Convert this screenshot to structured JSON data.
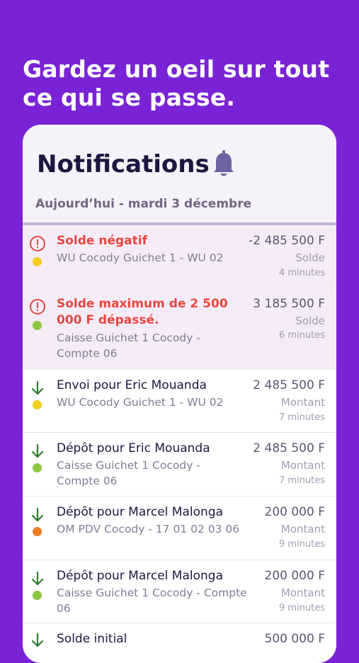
{
  "headline": "Gardez un oeil sur tout ce qui se passe.",
  "card": {
    "title": "Notifications",
    "date": "Aujourd’hui - mardi 3 décembre"
  },
  "colors": {
    "background": "#7a22d6",
    "alert_red": "#e8483d",
    "arrow_green": "#2e7d32",
    "dot_yellow": "#f4cf1e",
    "dot_green": "#8cc63f",
    "dot_orange": "#ee7b23"
  },
  "notifications": [
    {
      "icon": "alert-circle-icon",
      "dot": "yellow",
      "title": "Solde négatif",
      "subtitle": "WU Cocody Guichet 1 - WU 02",
      "amount": "-2 485 500 F",
      "label": "Solde",
      "time": "4 minutes"
    },
    {
      "icon": "alert-circle-icon",
      "dot": "green",
      "title": "Solde maximum de 2 500 000 F dépassé.",
      "subtitle": "Caisse Guichet 1 Cocody - Compte 06",
      "amount": "3 185 500 F",
      "label": "Solde",
      "time": "6 minutes"
    },
    {
      "icon": "arrow-down-icon",
      "dot": "yellow",
      "title": "Envoi pour Eric Mouanda",
      "subtitle": "WU Cocody Guichet 1 - WU 02",
      "amount": "2 485 500 F",
      "label": "Montant",
      "time": "7 minutes"
    },
    {
      "icon": "arrow-down-icon",
      "dot": "green",
      "title": "Dépôt pour Eric Mouanda",
      "subtitle": "Caisse Guichet 1 Cocody - Compte 06",
      "amount": "2 485 500 F",
      "label": "Montant",
      "time": "7 minutes"
    },
    {
      "icon": "arrow-down-icon",
      "dot": "orange",
      "title": "Dépôt pour Marcel Malonga",
      "subtitle": "OM PDV Cocody - 17 01 02 03 06",
      "amount": "200 000 F",
      "label": "Montant",
      "time": "9 minutes"
    },
    {
      "icon": "arrow-down-icon",
      "dot": "green",
      "title": "Dépôt pour Marcel Malonga",
      "subtitle": "Caisse Guichet 1 Cocody - Compte 06",
      "amount": "200 000 F",
      "label": "Montant",
      "time": "9 minutes"
    },
    {
      "icon": "arrow-down-icon",
      "dot": "green",
      "title": "Solde initial",
      "subtitle": "",
      "amount": "500 000 F",
      "label": "",
      "time": ""
    }
  ]
}
